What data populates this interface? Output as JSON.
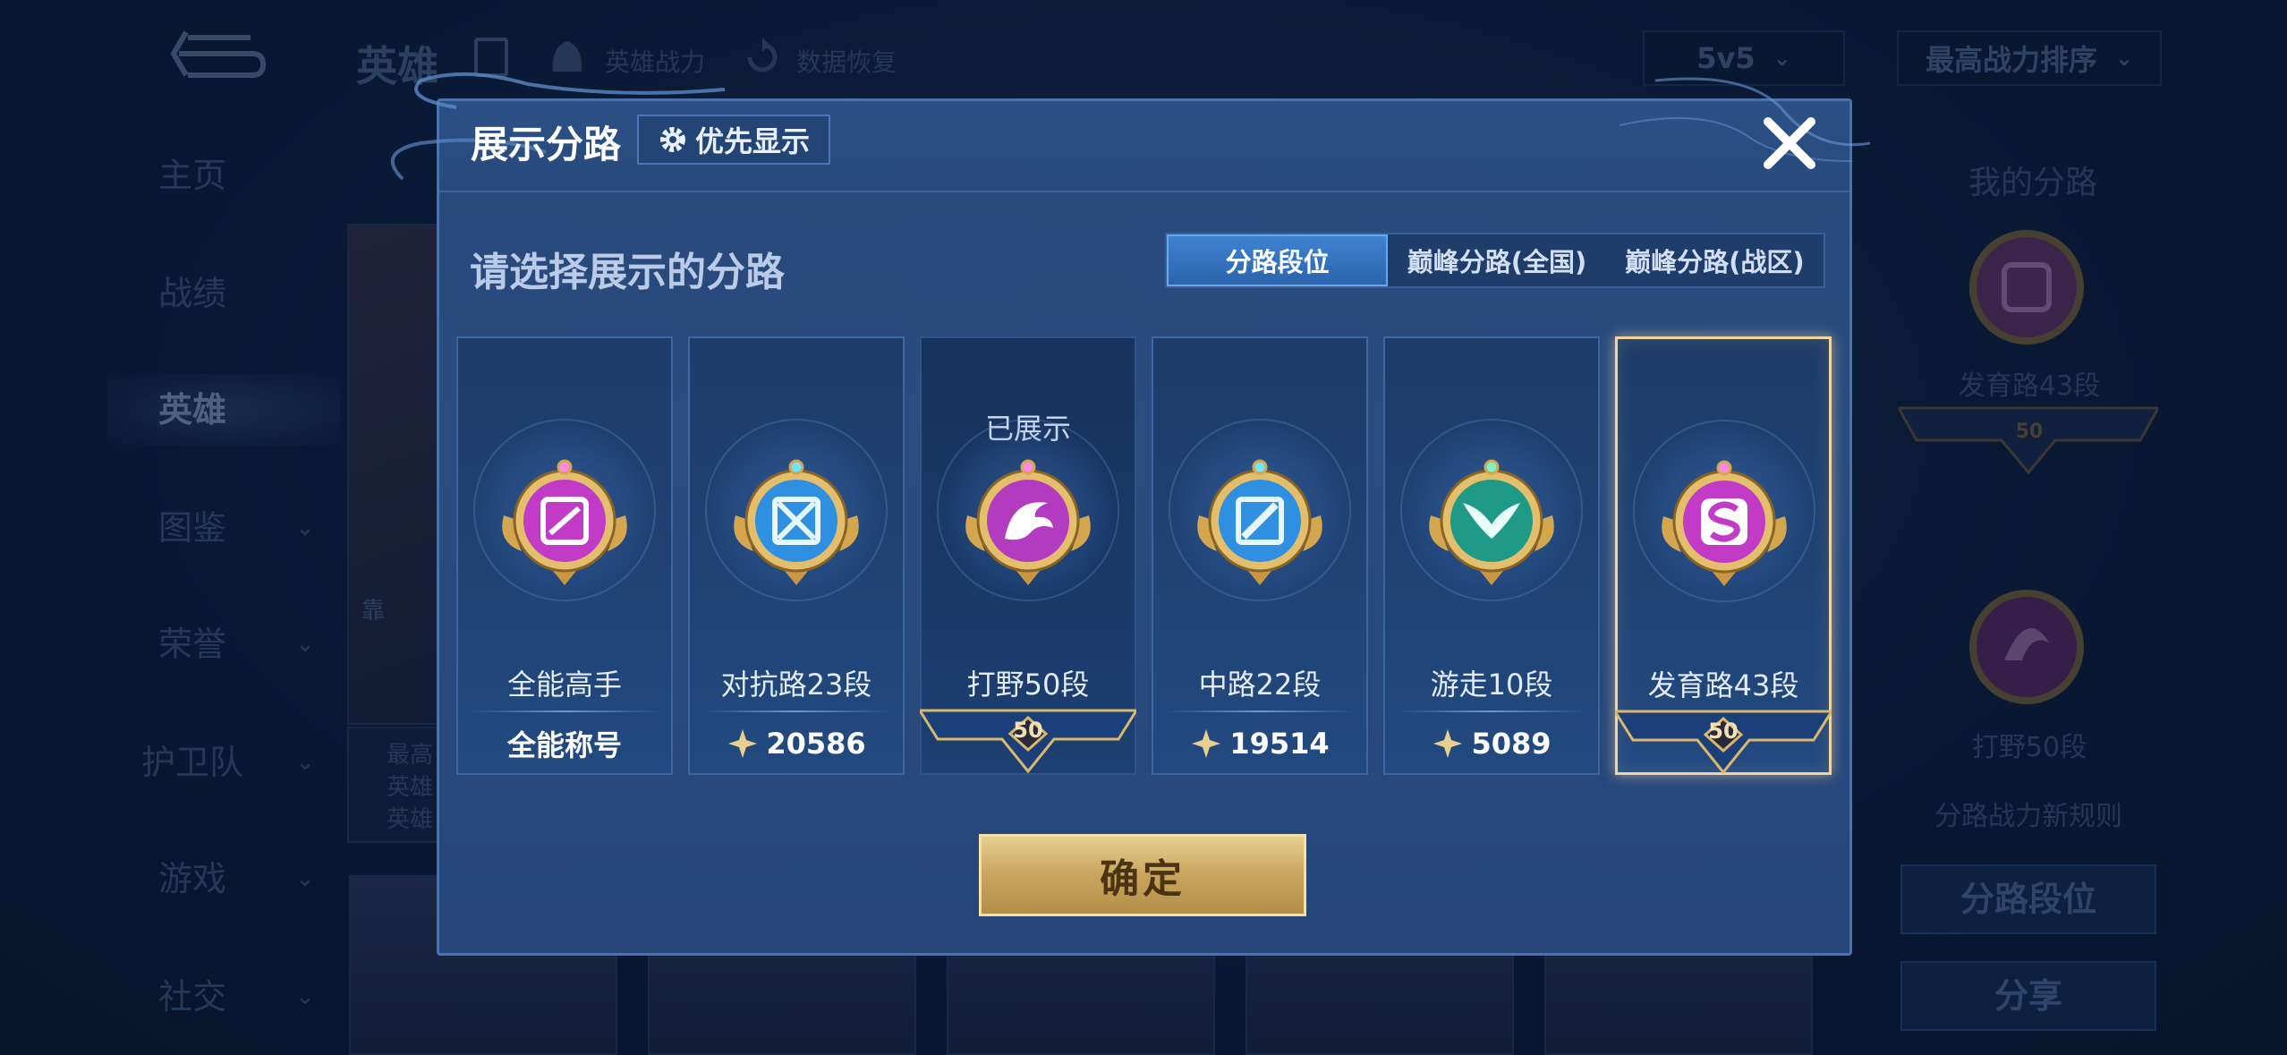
{
  "background": {
    "title": "英雄",
    "top_items": [
      "英雄战力",
      "数据恢复"
    ],
    "mode_select": "5v5",
    "sort_select": "最高战力排序",
    "sidebar": [
      {
        "label": "主页",
        "chevron": false
      },
      {
        "label": "战绩",
        "chevron": false
      },
      {
        "label": "英雄",
        "chevron": false,
        "active": true
      },
      {
        "label": "图鉴",
        "chevron": true
      },
      {
        "label": "荣誉",
        "chevron": true
      },
      {
        "label": "护卫队",
        "chevron": true
      },
      {
        "label": "游戏",
        "chevron": true
      },
      {
        "label": "社交",
        "chevron": true
      }
    ],
    "card_caption": [
      "最高",
      "英雄",
      "英雄"
    ],
    "card_mini_text": "靠",
    "right_panel": {
      "title": "我的分路",
      "lane1_label": "发育路43段",
      "lane1_level": "50",
      "lane2_label": "打野50段",
      "rules_text": "分路战力新规则",
      "btn_lane_rank": "分路段位",
      "btn_share": "分享"
    }
  },
  "modal": {
    "title": "展示分路",
    "priority_button": "优先显示",
    "subtitle": "请选择展示的分路",
    "tabs": [
      {
        "label": "分路段位",
        "active": true
      },
      {
        "label": "巅峰分路(全国)",
        "active": false
      },
      {
        "label": "巅峰分路(战区)",
        "active": false
      }
    ],
    "cards": [
      {
        "name": "全能高手",
        "stat": "全能称号",
        "stat_type": "text",
        "emblem_color": "#c23bc7",
        "emblem_icon": "allround-icon"
      },
      {
        "name": "对抗路23段",
        "stat": "20586",
        "stat_type": "power",
        "emblem_color": "#2f8fe0",
        "emblem_icon": "sword-icon"
      },
      {
        "name": "打野50段",
        "stat": "50",
        "stat_type": "plate",
        "shown_tag": "已展示",
        "emblem_color": "#b33bc0",
        "emblem_icon": "dragon-icon"
      },
      {
        "name": "中路22段",
        "stat": "19514",
        "stat_type": "power",
        "emblem_color": "#2f8fe0",
        "emblem_icon": "wand-icon"
      },
      {
        "name": "游走10段",
        "stat": "5089",
        "stat_type": "power",
        "emblem_color": "#1f9a86",
        "emblem_icon": "wings-icon"
      },
      {
        "name": "发育路43段",
        "stat": "50",
        "stat_type": "plate",
        "selected": true,
        "emblem_color": "#c23bc7",
        "emblem_icon": "arrow-icon"
      }
    ],
    "confirm_button": "确定"
  },
  "colors": {
    "modal_bg": "#28497a",
    "tab_active": "#3e83d1",
    "gold": "#d9b86e",
    "selected_border": "#f2d4a2"
  }
}
